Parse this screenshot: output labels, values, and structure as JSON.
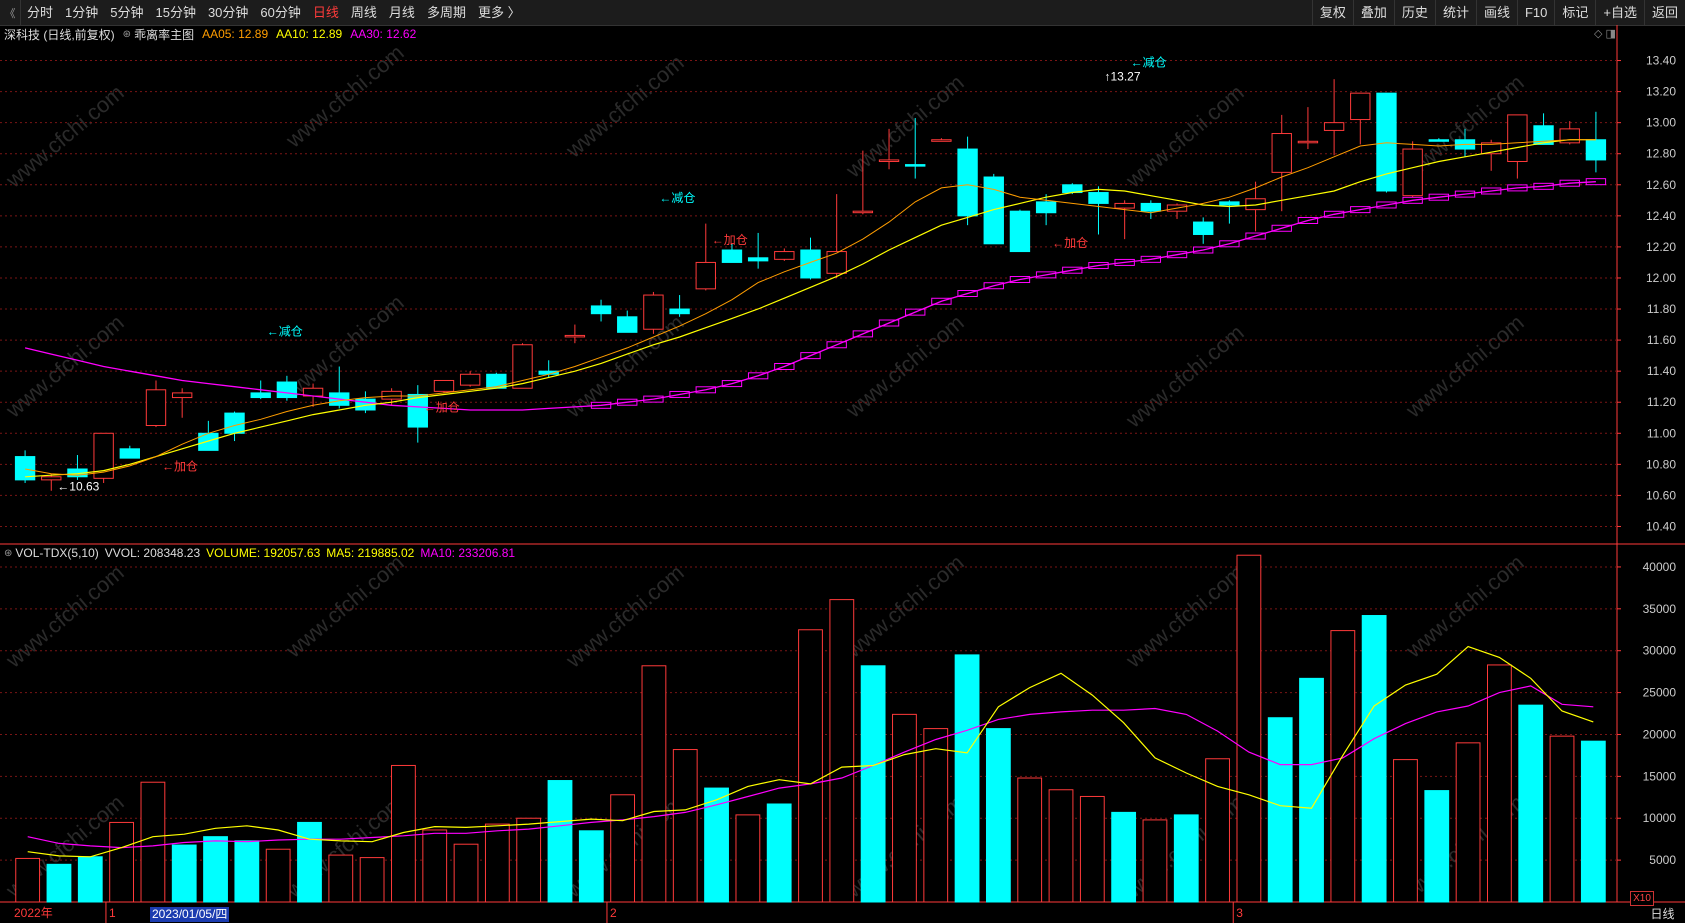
{
  "toolbar": {
    "corner_icon": "《",
    "tabs": [
      "分时",
      "1分钟",
      "5分钟",
      "15分钟",
      "30分钟",
      "60分钟",
      "日线",
      "周线",
      "月线",
      "多周期",
      "更多 〉"
    ],
    "active_tab": "日线",
    "tools": [
      "复权",
      "叠加",
      "历史",
      "统计",
      "画线",
      "F10",
      "标记",
      "+自选",
      "返回"
    ]
  },
  "main_panel": {
    "stock": "深科技 (日线,前复权)",
    "formula_icon": "⊛",
    "formula": "乖离率主图",
    "aa05": "AA05: 12.89",
    "aa10": "AA10: 12.89",
    "aa30": "AA30: 12.62",
    "panel_icons": "◇ ◨"
  },
  "volume_panel": {
    "icon": "⊛",
    "name": "VOL-TDX(5,10)",
    "vvol": "VVOL: 208348.23",
    "volume": "VOLUME: 192057.63",
    "ma5": "MA5: 219885.02",
    "ma10": "MA10: 233206.81"
  },
  "axis_bottom": {
    "year_label": "2022年",
    "month_labels": [
      {
        "index": 3,
        "label": "1"
      },
      {
        "index": 19,
        "label": "2"
      },
      {
        "index": 39,
        "label": "3"
      }
    ],
    "cursor_date": "2023/01/05/四",
    "x10": "X10",
    "period_tag": "日线"
  },
  "watermark": "www.cfchi.com",
  "colors": {
    "up": "#ff3a3a",
    "down": "#00ffff",
    "aa05": "#ff9d00",
    "aa10": "#ffff00",
    "aa30": "#ff00ff",
    "grid": "#7a1515",
    "axis": "#ff3a3a"
  },
  "chart_data": [
    {
      "type": "candlestick",
      "title": "深科技 (日线,前复权)",
      "ylim": [
        10.3,
        13.5
      ],
      "yticks": [
        10.4,
        10.6,
        10.8,
        11.0,
        11.2,
        11.4,
        11.6,
        11.8,
        12.0,
        12.2,
        12.4,
        12.6,
        12.8,
        13.0,
        13.2,
        13.4
      ],
      "candles": [
        {
          "o": 10.85,
          "h": 10.89,
          "l": 10.68,
          "c": 10.7
        },
        {
          "o": 10.7,
          "h": 10.74,
          "l": 10.63,
          "c": 10.72
        },
        {
          "o": 10.77,
          "h": 10.86,
          "l": 10.7,
          "c": 10.72
        },
        {
          "o": 10.71,
          "h": 11.0,
          "l": 10.68,
          "c": 11.0
        },
        {
          "o": 10.9,
          "h": 10.92,
          "l": 10.84,
          "c": 10.84
        },
        {
          "o": 11.05,
          "h": 11.34,
          "l": 11.04,
          "c": 11.28
        },
        {
          "o": 11.23,
          "h": 11.29,
          "l": 11.1,
          "c": 11.26
        },
        {
          "o": 11.0,
          "h": 11.08,
          "l": 10.98,
          "c": 10.89
        },
        {
          "o": 11.13,
          "h": 11.14,
          "l": 10.95,
          "c": 11.0
        },
        {
          "o": 11.26,
          "h": 11.34,
          "l": 11.22,
          "c": 11.23
        },
        {
          "o": 11.33,
          "h": 11.37,
          "l": 11.21,
          "c": 11.23
        },
        {
          "o": 11.24,
          "h": 11.32,
          "l": 11.17,
          "c": 11.29
        },
        {
          "o": 11.26,
          "h": 11.43,
          "l": 11.16,
          "c": 11.18
        },
        {
          "o": 11.22,
          "h": 11.27,
          "l": 11.13,
          "c": 11.15
        },
        {
          "o": 11.22,
          "h": 11.29,
          "l": 11.18,
          "c": 11.27
        },
        {
          "o": 11.25,
          "h": 11.31,
          "l": 10.94,
          "c": 11.04
        },
        {
          "o": 11.27,
          "h": 11.34,
          "l": 11.26,
          "c": 11.34
        },
        {
          "o": 11.31,
          "h": 11.4,
          "l": 11.3,
          "c": 11.38
        },
        {
          "o": 11.38,
          "h": 11.39,
          "l": 11.29,
          "c": 11.29
        },
        {
          "o": 11.29,
          "h": 11.58,
          "l": 11.29,
          "c": 11.57
        },
        {
          "o": 11.4,
          "h": 11.47,
          "l": 11.36,
          "c": 11.38
        },
        {
          "o": 11.63,
          "h": 11.7,
          "l": 11.58,
          "c": 11.63
        },
        {
          "o": 11.82,
          "h": 11.86,
          "l": 11.72,
          "c": 11.77
        },
        {
          "o": 11.75,
          "h": 11.79,
          "l": 11.68,
          "c": 11.65
        },
        {
          "o": 11.67,
          "h": 11.91,
          "l": 11.64,
          "c": 11.89
        },
        {
          "o": 11.8,
          "h": 11.89,
          "l": 11.75,
          "c": 11.77
        },
        {
          "o": 11.93,
          "h": 12.35,
          "l": 11.92,
          "c": 12.1
        },
        {
          "o": 12.18,
          "h": 12.22,
          "l": 12.12,
          "c": 12.1
        },
        {
          "o": 12.13,
          "h": 12.29,
          "l": 12.06,
          "c": 12.11
        },
        {
          "o": 12.12,
          "h": 12.19,
          "l": 12.11,
          "c": 12.17
        },
        {
          "o": 12.18,
          "h": 12.26,
          "l": 11.99,
          "c": 12.0
        },
        {
          "o": 12.03,
          "h": 12.54,
          "l": 12.0,
          "c": 12.17
        },
        {
          "o": 12.43,
          "h": 12.82,
          "l": 12.41,
          "c": 12.43
        },
        {
          "o": 12.75,
          "h": 12.96,
          "l": 12.7,
          "c": 12.76
        },
        {
          "o": 12.73,
          "h": 13.03,
          "l": 12.64,
          "c": 12.72
        },
        {
          "o": 12.88,
          "h": 12.9,
          "l": 12.88,
          "c": 12.89
        },
        {
          "o": 12.83,
          "h": 12.91,
          "l": 12.34,
          "c": 12.4
        },
        {
          "o": 12.65,
          "h": 12.67,
          "l": 12.24,
          "c": 12.22
        },
        {
          "o": 12.43,
          "h": 12.44,
          "l": 12.19,
          "c": 12.17
        },
        {
          "o": 12.49,
          "h": 12.54,
          "l": 12.34,
          "c": 12.42
        },
        {
          "o": 12.6,
          "h": 12.61,
          "l": 12.54,
          "c": 12.55
        },
        {
          "o": 12.55,
          "h": 12.59,
          "l": 12.28,
          "c": 12.48
        },
        {
          "o": 12.45,
          "h": 12.5,
          "l": 12.25,
          "c": 12.48
        },
        {
          "o": 12.48,
          "h": 12.5,
          "l": 12.38,
          "c": 12.43
        },
        {
          "o": 12.43,
          "h": 12.48,
          "l": 12.38,
          "c": 12.47
        },
        {
          "o": 12.36,
          "h": 12.39,
          "l": 12.22,
          "c": 12.28
        },
        {
          "o": 12.49,
          "h": 12.5,
          "l": 12.35,
          "c": 12.47
        },
        {
          "o": 12.44,
          "h": 12.62,
          "l": 12.3,
          "c": 12.51
        },
        {
          "o": 12.68,
          "h": 13.05,
          "l": 12.43,
          "c": 12.93
        },
        {
          "o": 12.88,
          "h": 13.1,
          "l": 12.83,
          "c": 12.88
        },
        {
          "o": 12.95,
          "h": 13.28,
          "l": 12.79,
          "c": 13.0
        },
        {
          "o": 13.02,
          "h": 13.1,
          "l": 12.86,
          "c": 13.19
        },
        {
          "o": 13.19,
          "h": 13.19,
          "l": 12.55,
          "c": 12.56
        },
        {
          "o": 12.53,
          "h": 12.88,
          "l": 12.5,
          "c": 12.83
        },
        {
          "o": 12.89,
          "h": 12.9,
          "l": 12.88,
          "c": 12.88
        },
        {
          "o": 12.89,
          "h": 12.96,
          "l": 12.78,
          "c": 12.83
        },
        {
          "o": 12.8,
          "h": 12.89,
          "l": 12.69,
          "c": 12.87
        },
        {
          "o": 12.75,
          "h": 13.01,
          "l": 12.64,
          "c": 13.05
        },
        {
          "o": 12.98,
          "h": 13.06,
          "l": 12.86,
          "c": 12.86
        },
        {
          "o": 12.87,
          "h": 13.01,
          "l": 12.86,
          "c": 12.96
        },
        {
          "o": 12.89,
          "h": 13.07,
          "l": 12.68,
          "c": 12.76
        }
      ],
      "aa05": [
        10.77,
        10.74,
        10.73,
        10.75,
        10.79,
        10.85,
        10.93,
        11.0,
        11.05,
        11.09,
        11.14,
        11.18,
        11.21,
        11.23,
        11.24,
        11.24,
        11.26,
        11.28,
        11.3,
        11.34,
        11.38,
        11.43,
        11.49,
        11.55,
        11.62,
        11.69,
        11.77,
        11.86,
        11.97,
        12.04,
        12.1,
        12.16,
        12.25,
        12.36,
        12.49,
        12.58,
        12.6,
        12.57,
        12.52,
        12.5,
        12.48,
        12.46,
        12.44,
        12.42,
        12.45,
        12.48,
        12.52,
        12.58,
        12.65,
        12.71,
        12.78,
        12.85,
        12.87,
        12.86,
        12.85,
        12.86,
        12.86,
        12.87,
        12.88,
        12.89,
        12.89
      ],
      "aa10": [
        10.72,
        10.73,
        10.74,
        10.76,
        10.8,
        10.85,
        10.9,
        10.95,
        11.0,
        11.04,
        11.08,
        11.12,
        11.15,
        11.18,
        11.2,
        11.23,
        11.25,
        11.27,
        11.29,
        11.32,
        11.36,
        11.4,
        11.45,
        11.51,
        11.57,
        11.62,
        11.68,
        11.74,
        11.8,
        11.87,
        11.94,
        12.01,
        12.09,
        12.18,
        12.26,
        12.34,
        12.39,
        12.44,
        12.48,
        12.52,
        12.55,
        12.57,
        12.56,
        12.53,
        12.5,
        12.47,
        12.46,
        12.47,
        12.5,
        12.53,
        12.56,
        12.62,
        12.67,
        12.71,
        12.75,
        12.78,
        12.81,
        12.84,
        12.87,
        12.89,
        12.89
      ],
      "aa30": [
        11.55,
        11.51,
        11.47,
        11.43,
        11.4,
        11.37,
        11.34,
        11.32,
        11.3,
        11.28,
        11.26,
        11.24,
        11.22,
        11.2,
        11.18,
        11.17,
        11.16,
        11.15,
        11.15,
        11.15,
        11.16,
        11.17,
        11.18,
        11.2,
        11.22,
        11.25,
        11.28,
        11.32,
        11.37,
        11.43,
        11.5,
        11.57,
        11.64,
        11.71,
        11.78,
        11.85,
        11.9,
        11.95,
        11.99,
        12.02,
        12.05,
        12.08,
        12.1,
        12.12,
        12.15,
        12.18,
        12.22,
        12.27,
        12.32,
        12.37,
        12.41,
        12.44,
        12.47,
        12.5,
        12.52,
        12.54,
        12.56,
        12.58,
        12.59,
        12.61,
        12.62
      ],
      "annotations": [
        {
          "index": 1,
          "value": 10.63,
          "text": "←10.63",
          "color": "#ffffff"
        },
        {
          "index": 9,
          "value": 11.63,
          "text": "←减仓",
          "color": "#00ffff"
        },
        {
          "index": 15,
          "value": 11.14,
          "text": "←加仓",
          "color": "#ff3a3a"
        },
        {
          "index": 24,
          "value": 12.49,
          "text": "←减仓",
          "color": "#00ffff"
        },
        {
          "index": 26,
          "value": 12.22,
          "text": "←加仓",
          "color": "#ff3a3a"
        },
        {
          "index": 39,
          "value": 12.2,
          "text": "←加仓",
          "color": "#ff3a3a"
        },
        {
          "index": 42,
          "value": 13.36,
          "text": "←减仓",
          "color": "#00ffff"
        },
        {
          "index": 41,
          "value": 13.27,
          "text": "↑13.27",
          "color": "#ffffff"
        },
        {
          "index": 5,
          "value": 10.76,
          "text": "←加仓",
          "color": "#ff3a3a"
        }
      ]
    },
    {
      "type": "bar",
      "title": "VOL-TDX(5,10)",
      "ylim": [
        0,
        42500
      ],
      "yticks": [
        5000,
        10000,
        15000,
        20000,
        25000,
        30000,
        35000,
        40000
      ],
      "values": [
        5200,
        4500,
        5400,
        9500,
        14300,
        6800,
        7800,
        7300,
        6300,
        9500,
        5600,
        5300,
        16300,
        8600,
        6900,
        9300,
        10000,
        14500,
        8500,
        12800,
        28200,
        18200,
        13600,
        10400,
        11700,
        32500,
        36100,
        28200,
        22400,
        20700,
        29500,
        20700,
        14800,
        13400,
        12600,
        10700,
        9800,
        10400,
        17100,
        41400,
        22000,
        26700,
        32400,
        34200,
        17000,
        13300,
        19000,
        28300,
        23500,
        19800,
        19200
      ],
      "ma5": [
        6000,
        5500,
        5400,
        6500,
        7800,
        8100,
        8800,
        9100,
        8600,
        7500,
        7300,
        7200,
        8300,
        9000,
        8900,
        9100,
        9300,
        9600,
        9900,
        9700,
        10800,
        11000,
        12200,
        13800,
        14600,
        14100,
        16100,
        16300,
        17600,
        18300,
        17800,
        23300,
        25600,
        27300,
        24700,
        21400,
        17200,
        15400,
        13800,
        12800,
        11500,
        11200,
        17500,
        23400,
        25900,
        27200,
        30500,
        29200,
        26700,
        22800,
        21500
      ],
      "ma10": [
        7800,
        7000,
        6700,
        6500,
        6700,
        7100,
        7300,
        7200,
        7400,
        7500,
        7500,
        7700,
        7900,
        8200,
        8200,
        8500,
        8700,
        9100,
        9500,
        9800,
        10200,
        10700,
        11600,
        12600,
        13600,
        14100,
        14800,
        16300,
        17900,
        19400,
        20500,
        21800,
        22400,
        22700,
        22900,
        22900,
        23100,
        22400,
        20400,
        17900,
        16400,
        16400,
        17200,
        19500,
        21300,
        22700,
        23400,
        25000,
        25800,
        23600,
        23300
      ],
      "bar_up": [
        true,
        false,
        false,
        true,
        true,
        false,
        false,
        false,
        true,
        false,
        true,
        true,
        true,
        true,
        true,
        true,
        true,
        false,
        false,
        true,
        true,
        true,
        false,
        true,
        false,
        true,
        true,
        false,
        true,
        true,
        false,
        false,
        true,
        true,
        true,
        false,
        true,
        false,
        true,
        true,
        false,
        false,
        true,
        false,
        true,
        false,
        true,
        true,
        false,
        true,
        false
      ]
    }
  ]
}
